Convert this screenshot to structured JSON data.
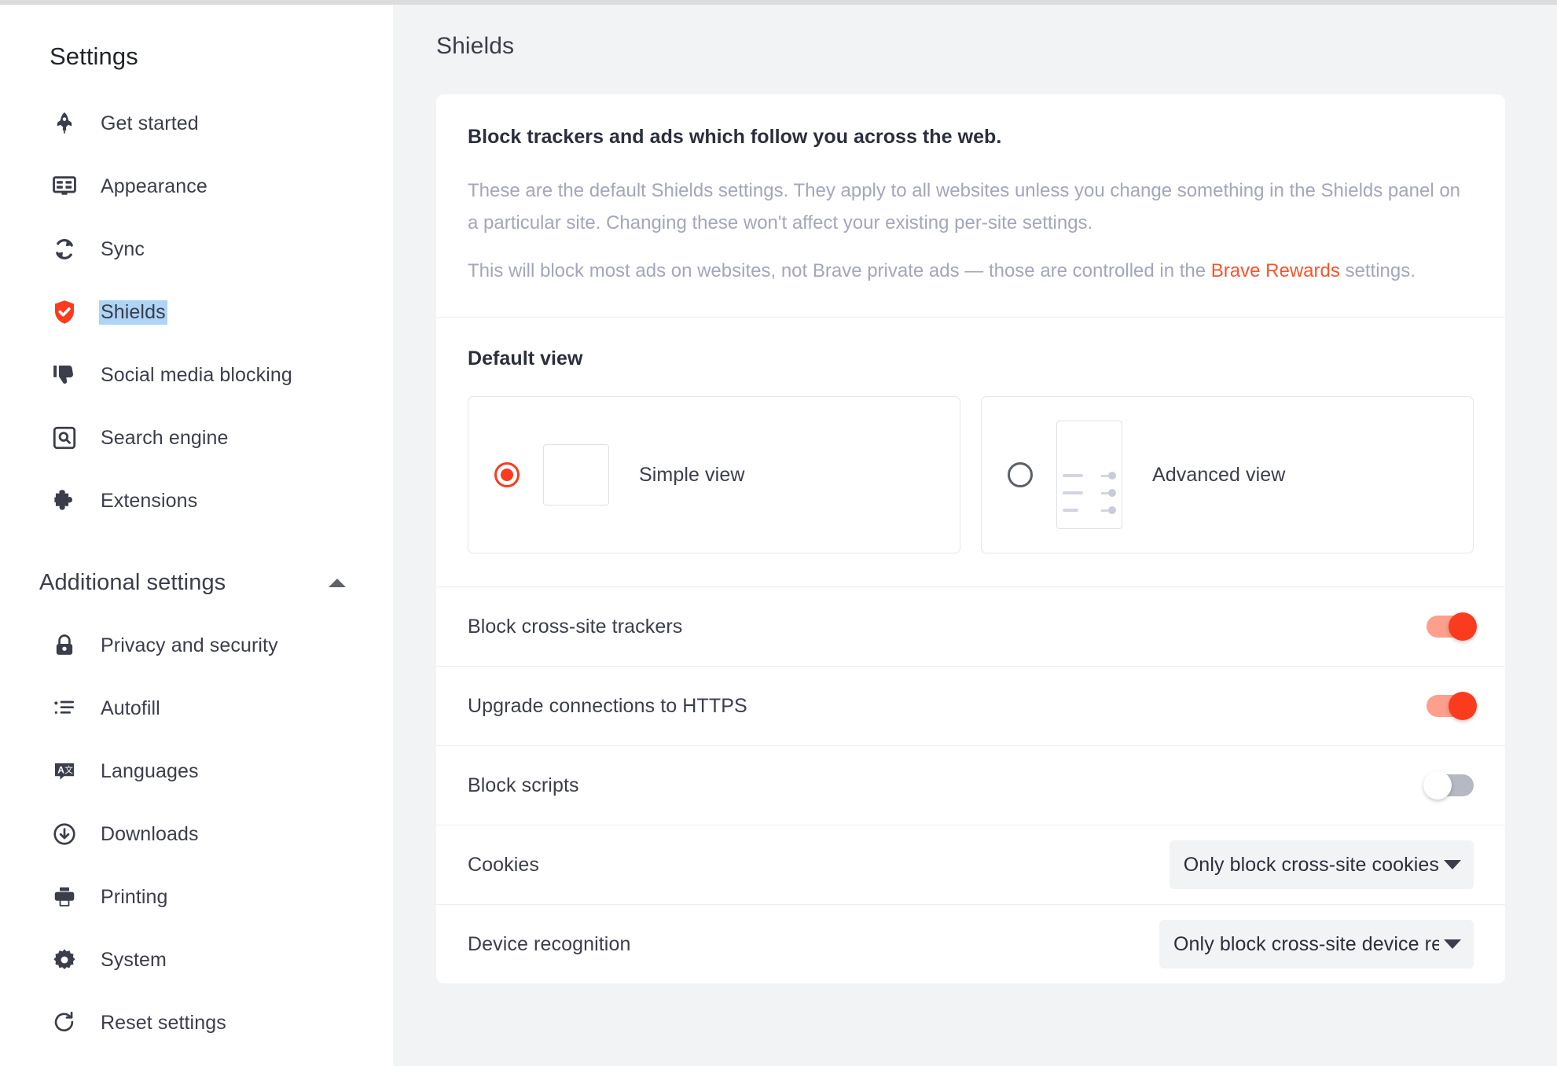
{
  "sidebar": {
    "title": "Settings",
    "items": [
      {
        "label": "Get started",
        "icon": "rocket-icon",
        "selected": false
      },
      {
        "label": "Appearance",
        "icon": "appearance-icon",
        "selected": false
      },
      {
        "label": "Sync",
        "icon": "sync-icon",
        "selected": false
      },
      {
        "label": "Shields",
        "icon": "shield-icon",
        "selected": true
      },
      {
        "label": "Social media blocking",
        "icon": "thumbs-down-icon",
        "selected": false
      },
      {
        "label": "Search engine",
        "icon": "search-icon",
        "selected": false
      },
      {
        "label": "Extensions",
        "icon": "puzzle-icon",
        "selected": false
      }
    ],
    "additional_settings": {
      "label": "Additional settings",
      "expanded": true,
      "collapse_icon": "chevron-up-icon",
      "items": [
        {
          "label": "Privacy and security",
          "icon": "lock-icon"
        },
        {
          "label": "Autofill",
          "icon": "list-icon"
        },
        {
          "label": "Languages",
          "icon": "languages-icon"
        },
        {
          "label": "Downloads",
          "icon": "download-icon"
        },
        {
          "label": "Printing",
          "icon": "printer-icon"
        },
        {
          "label": "System",
          "icon": "gear-icon"
        },
        {
          "label": "Reset settings",
          "icon": "reset-icon"
        }
      ]
    }
  },
  "main": {
    "page_title": "Shields",
    "intro": {
      "heading": "Block trackers and ads which follow you across the web.",
      "paragraph1": "These are the default Shields settings. They apply to all websites unless you change something in the Shields panel on a particular site. Changing these won't affect your existing per-site settings.",
      "paragraph2_before": "This will block most ads on websites, not Brave private ads — those are controlled in the ",
      "paragraph2_link": "Brave Rewards",
      "paragraph2_after": " settings."
    },
    "default_view": {
      "heading": "Default view",
      "options": [
        {
          "label": "Simple view",
          "selected": true,
          "thumb": "simple-view-thumbnail"
        },
        {
          "label": "Advanced view",
          "selected": false,
          "thumb": "advanced-view-thumbnail"
        }
      ]
    },
    "settings": [
      {
        "label": "Block cross-site trackers",
        "control": "toggle",
        "value": "on"
      },
      {
        "label": "Upgrade connections to HTTPS",
        "control": "toggle",
        "value": "on"
      },
      {
        "label": "Block scripts",
        "control": "toggle",
        "value": "off"
      },
      {
        "label": "Cookies",
        "control": "dropdown",
        "value": "Only block cross-site cookies"
      },
      {
        "label": "Device recognition",
        "control": "dropdown",
        "value": "Only block cross-site device recognition"
      }
    ]
  },
  "colors": {
    "accent_red": "#fb3b1e",
    "link_red": "#fb542b",
    "toggle_on_track": "#fc9f8c",
    "toggle_off_track": "#b5b9c2",
    "selection_blue": "#aed4f7",
    "page_bg": "#f1f3f5",
    "card_bg": "#ffffff",
    "text_primary": "#3b3e4a",
    "text_muted": "#a3a7b8"
  }
}
